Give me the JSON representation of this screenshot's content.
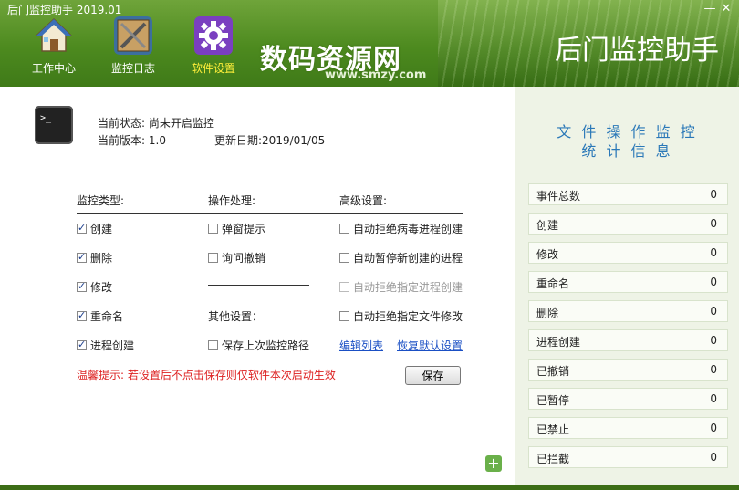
{
  "window": {
    "title": "后门监控助手 2019.01"
  },
  "toolbar": {
    "items": [
      {
        "label": "工作中心"
      },
      {
        "label": "监控日志"
      },
      {
        "label": "软件设置"
      }
    ]
  },
  "watermark": {
    "text": "数码资源网",
    "url": "www.smzy.com"
  },
  "app_title": "后门监控助手",
  "status": {
    "state_label": "当前状态:",
    "state_value": "尚未开启监控",
    "version_label": "当前版本:",
    "version_value": "1.0",
    "update_label": "更新日期:",
    "update_value": "2019/01/05"
  },
  "settings": {
    "col1_header": "监控类型:",
    "col2_header": "操作处理:",
    "col3_header": "高级设置:",
    "monitor_types": [
      {
        "label": "创建",
        "checked": true
      },
      {
        "label": "删除",
        "checked": true
      },
      {
        "label": "修改",
        "checked": true
      },
      {
        "label": "重命名",
        "checked": true
      },
      {
        "label": "进程创建",
        "checked": true
      }
    ],
    "actions": [
      {
        "label": "弹窗提示",
        "checked": false
      },
      {
        "label": "询问撤销",
        "checked": false
      }
    ],
    "other_header": "其他设置：",
    "other_option": {
      "label": "保存上次监控路径",
      "checked": false
    },
    "advanced": [
      {
        "label": "自动拒绝病毒进程创建",
        "checked": false,
        "disabled": false
      },
      {
        "label": "自动暂停新创建的进程",
        "checked": false,
        "disabled": false
      },
      {
        "label": "自动拒绝指定进程创建",
        "checked": false,
        "disabled": true
      },
      {
        "label": "自动拒绝指定文件修改",
        "checked": false,
        "disabled": false
      }
    ],
    "edit_list_link": "编辑列表",
    "restore_default_link": "恢复默认设置",
    "warning": "温馨提示: 若设置后不点击保存则仅软件本次启动生效",
    "save_button": "保存"
  },
  "sidebar": {
    "title_line1": "文 件 操 作 监 控",
    "title_line2": "统 计 信 息",
    "stats": [
      {
        "name": "事件总数",
        "value": "0"
      },
      {
        "name": "创建",
        "value": "0"
      },
      {
        "name": "修改",
        "value": "0"
      },
      {
        "name": "重命名",
        "value": "0"
      },
      {
        "name": "删除",
        "value": "0"
      },
      {
        "name": "进程创建",
        "value": "0"
      },
      {
        "name": "已撤销",
        "value": "0"
      },
      {
        "name": "已暂停",
        "value": "0"
      },
      {
        "name": "已禁止",
        "value": "0"
      },
      {
        "name": "已拦截",
        "value": "0"
      }
    ]
  }
}
